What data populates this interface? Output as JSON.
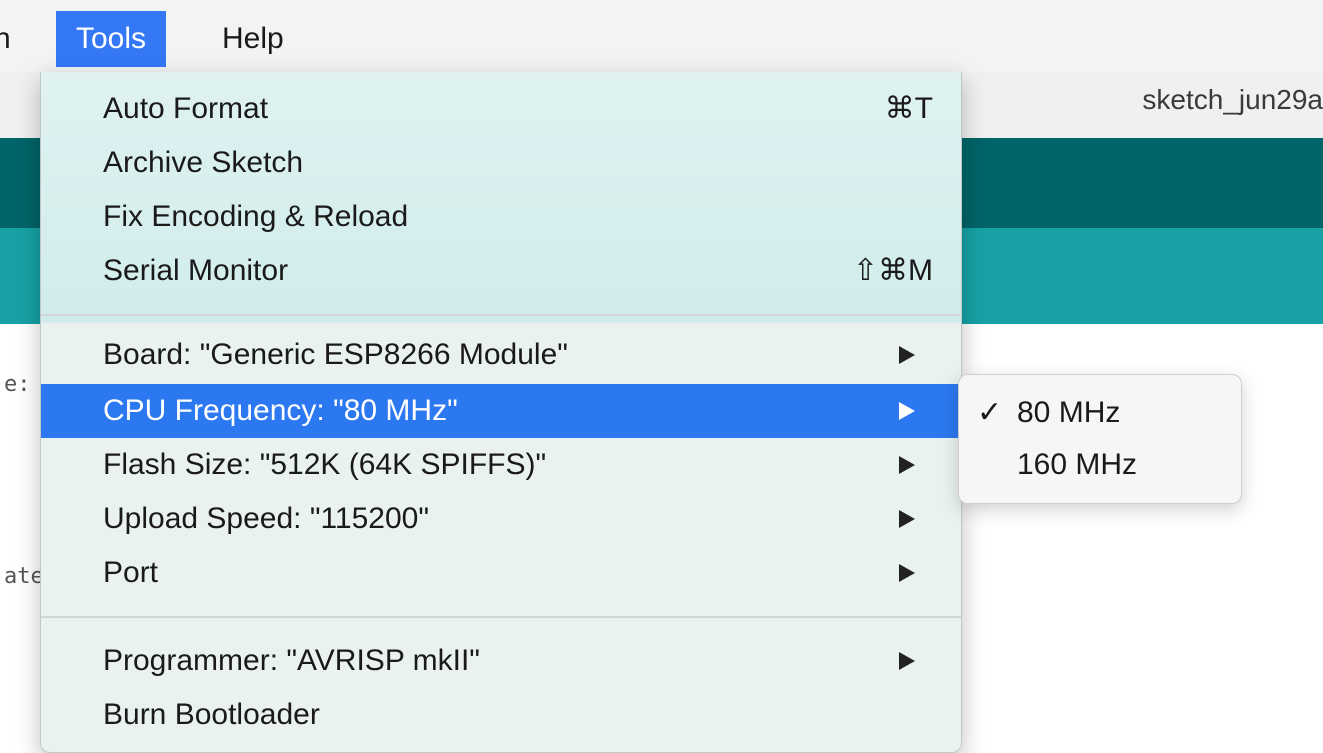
{
  "menubar": {
    "left_fragment": "n",
    "tools": "Tools",
    "help": "Help"
  },
  "window": {
    "title": "sketch_jun29a",
    "editor_fragments": [
      "e:",
      "ate"
    ]
  },
  "tools_menu": {
    "items": [
      {
        "label": "Auto Format",
        "shortcut": "⌘T"
      },
      {
        "label": "Archive Sketch",
        "shortcut": ""
      },
      {
        "label": "Fix Encoding & Reload",
        "shortcut": ""
      },
      {
        "label": "Serial Monitor",
        "shortcut": "⇧⌘M"
      },
      {
        "label": "Board: \"Generic ESP8266 Module\"",
        "submenu": true
      },
      {
        "label": "CPU Frequency: \"80 MHz\"",
        "submenu": true,
        "highlighted": true
      },
      {
        "label": "Flash Size: \"512K (64K SPIFFS)\"",
        "submenu": true
      },
      {
        "label": "Upload Speed: \"115200\"",
        "submenu": true
      },
      {
        "label": "Port",
        "submenu": true
      },
      {
        "label": "Programmer: \"AVRISP mkII\"",
        "submenu": true
      },
      {
        "label": "Burn Bootloader",
        "shortcut": ""
      }
    ]
  },
  "cpu_submenu": {
    "items": [
      {
        "label": "80 MHz",
        "checked": true,
        "check": "✓"
      },
      {
        "label": "160 MHz",
        "checked": false,
        "check": ""
      }
    ]
  },
  "colors": {
    "highlight": "#2c78f0",
    "toolbar_dark": "#006468",
    "toolbar_teal": "#17a1a5"
  }
}
